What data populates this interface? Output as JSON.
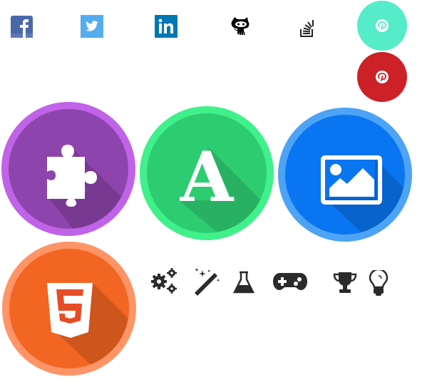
{
  "social_icons": [
    {
      "name": "facebook-icon",
      "color": "#3b5998"
    },
    {
      "name": "twitter-icon",
      "color": "#55acee"
    },
    {
      "name": "linkedin-icon",
      "color": "#0077b5"
    },
    {
      "name": "github-icon",
      "color": "#000000"
    },
    {
      "name": "stackoverflow-icon",
      "color": "#222222"
    }
  ],
  "pinterest_buttons": [
    {
      "name": "pinterest-teal",
      "color": "#56ebc9"
    },
    {
      "name": "pinterest-red",
      "color": "#cd2128"
    }
  ],
  "large_icons": [
    {
      "name": "puzzle-icon",
      "ring": "#c063e8",
      "fill": "#8e44ad"
    },
    {
      "name": "font-icon",
      "ring": "#40f08a",
      "fill": "#2ecc71",
      "glyph": "A"
    },
    {
      "name": "image-icon",
      "ring": "#4da3f5",
      "fill": "#0a75f0"
    },
    {
      "name": "html5-icon",
      "ring": "#ff9466",
      "fill": "#f26522",
      "glyph": "5"
    }
  ],
  "small_icons": [
    "gears-icon",
    "magic-wand-icon",
    "flask-icon",
    "gamepad-icon",
    "trophy-icon",
    "lightbulb-icon"
  ],
  "icon_dark": "#2b2b2b"
}
